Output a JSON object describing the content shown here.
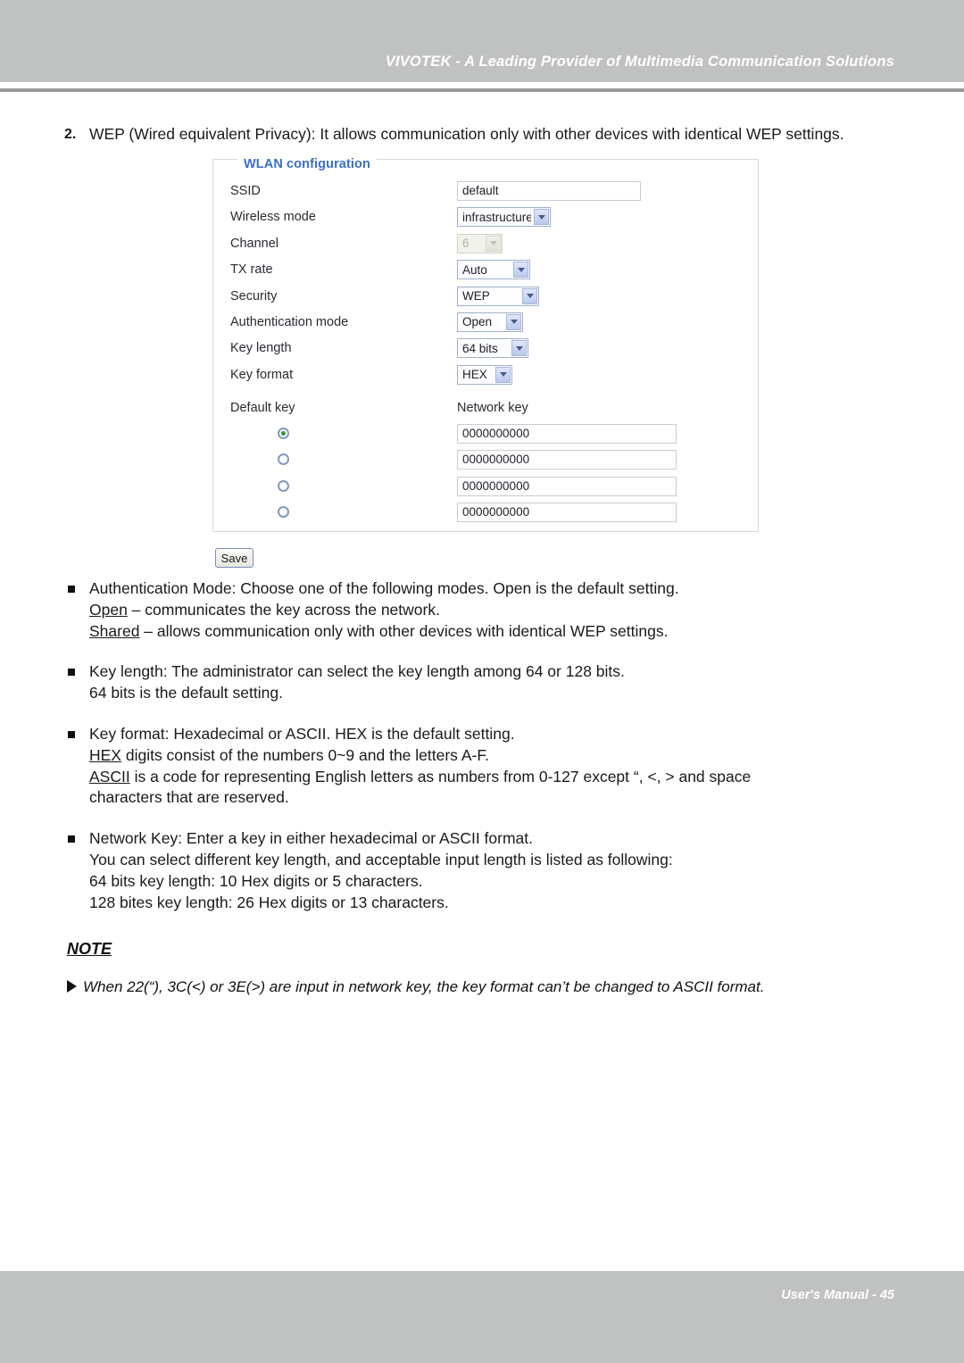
{
  "header": {
    "title": "VIVOTEK - A Leading Provider of Multimedia Communication Solutions"
  },
  "footer": {
    "text": "User's Manual - 45"
  },
  "intro": {
    "number": "2.",
    "text": "WEP (Wired equivalent Privacy): It allows communication only with other devices with identical WEP settings."
  },
  "wlan_panel": {
    "legend": "WLAN configuration",
    "fields": [
      {
        "label": "SSID",
        "type": "text",
        "value": "default"
      },
      {
        "label": "Wireless mode",
        "type": "select",
        "value": "infrastructure",
        "disabled": false
      },
      {
        "label": "Channel",
        "type": "select",
        "value": "6",
        "disabled": true
      },
      {
        "label": "TX rate",
        "type": "select",
        "value": "Auto",
        "disabled": false
      },
      {
        "label": "Security",
        "type": "select",
        "value": "WEP",
        "disabled": false
      },
      {
        "label": "Authentication mode",
        "type": "select",
        "value": "Open",
        "disabled": false
      },
      {
        "label": "Key length",
        "type": "select",
        "value": "64 bits",
        "disabled": false
      },
      {
        "label": "Key format",
        "type": "select",
        "value": "HEX",
        "disabled": false
      }
    ],
    "key_table": {
      "default_key_header": "Default key",
      "network_key_header": "Network key",
      "rows": [
        {
          "selected": true,
          "key": "0000000000"
        },
        {
          "selected": false,
          "key": "0000000000"
        },
        {
          "selected": false,
          "key": "0000000000"
        },
        {
          "selected": false,
          "key": "0000000000"
        }
      ]
    },
    "save_label": "Save"
  },
  "bullets": [
    {
      "lines": [
        {
          "text": "Authentication Mode: Choose one of the following modes. Open is the default setting."
        },
        {
          "underlined": "Open",
          "text": " – communicates the key across the network."
        },
        {
          "underlined": "Shared",
          "text": " – allows communication only with other devices with identical WEP settings."
        }
      ]
    },
    {
      "lines": [
        {
          "text": "Key length: The administrator can select the key length among 64 or 128 bits."
        },
        {
          "text": "64 bits is the default setting."
        }
      ]
    },
    {
      "lines": [
        {
          "text": "Key format: Hexadecimal or ASCII. HEX is the default setting."
        },
        {
          "underlined": "HEX",
          "text": " digits consist of the numbers 0~9 and the letters A-F."
        },
        {
          "underlined": "ASCII",
          "text": " is a code for representing English letters as numbers from 0-127 except “, <, > and space"
        },
        {
          "text": "characters that are reserved."
        }
      ]
    },
    {
      "lines": [
        {
          "text": "Network Key: Enter a key in either hexadecimal or ASCII format."
        },
        {
          "text": "You can select different key length,  and acceptable input length is listed as following:"
        },
        {
          "text": "64 bits key length: 10 Hex digits or 5 characters."
        },
        {
          "text": "128 bites key length: 26 Hex digits or 13 characters."
        }
      ]
    }
  ],
  "note": {
    "title": "NOTE",
    "text": "When 22(“), 3C(<) or 3E(>) are input in network key, the key format can’t be changed to ASCII format."
  },
  "colors": {
    "band": "#c0c1c1",
    "legend_blue": "#3a6fc4",
    "radio_selected": "#2e9b3e"
  }
}
